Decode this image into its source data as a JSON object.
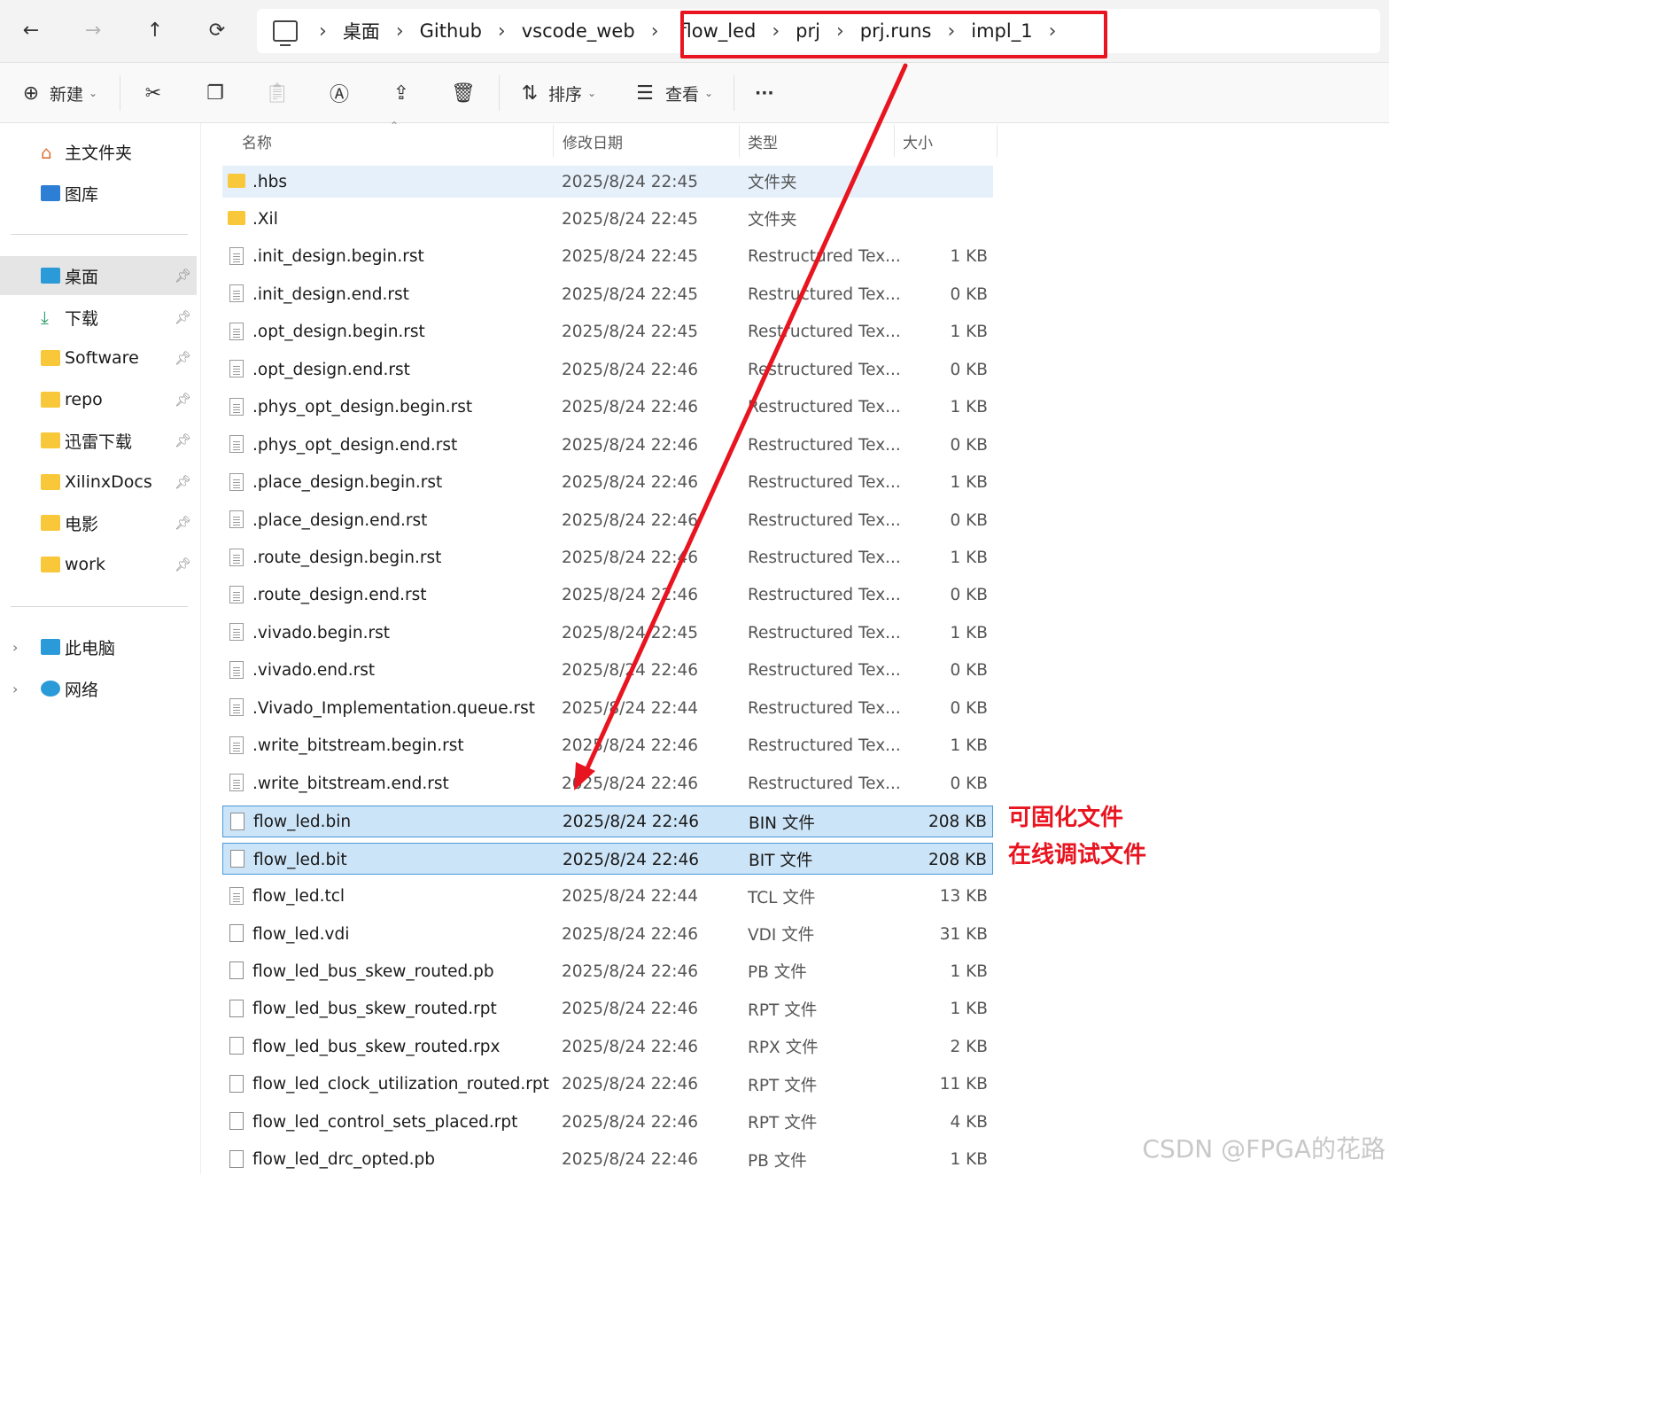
{
  "nav": {
    "back": "←",
    "forward": "→",
    "up": "↑",
    "refresh": "⟳"
  },
  "breadcrumb": [
    "桌面",
    "Github",
    "vscode_web",
    "flow_led",
    "prj",
    "prj.runs",
    "impl_1"
  ],
  "toolbar": {
    "new_label": "新建",
    "sort_label": "排序",
    "view_label": "查看",
    "more_label": "···"
  },
  "sidebar": {
    "quick": [
      {
        "label": "主文件夹"
      },
      {
        "label": "图库"
      }
    ],
    "pinned": [
      {
        "label": "桌面"
      },
      {
        "label": "下载"
      },
      {
        "label": "Software"
      },
      {
        "label": "repo"
      },
      {
        "label": "迅雷下载"
      },
      {
        "label": "XilinxDocs"
      },
      {
        "label": "电影"
      },
      {
        "label": "work"
      }
    ],
    "devices": [
      {
        "label": "此电脑"
      },
      {
        "label": "网络"
      }
    ]
  },
  "columns": {
    "name": "名称",
    "date": "修改日期",
    "type": "类型",
    "size": "大小"
  },
  "files": [
    {
      "name": ".hbs",
      "date": "2025/8/24 22:45",
      "type": "文件夹",
      "size": ""
    },
    {
      "name": ".Xil",
      "date": "2025/8/24 22:45",
      "type": "文件夹",
      "size": ""
    },
    {
      "name": ".init_design.begin.rst",
      "date": "2025/8/24 22:45",
      "type": "Restructured Tex...",
      "size": "1 KB"
    },
    {
      "name": ".init_design.end.rst",
      "date": "2025/8/24 22:45",
      "type": "Restructured Tex...",
      "size": "0 KB"
    },
    {
      "name": ".opt_design.begin.rst",
      "date": "2025/8/24 22:45",
      "type": "Restructured Tex...",
      "size": "1 KB"
    },
    {
      "name": ".opt_design.end.rst",
      "date": "2025/8/24 22:46",
      "type": "Restructured Tex...",
      "size": "0 KB"
    },
    {
      "name": ".phys_opt_design.begin.rst",
      "date": "2025/8/24 22:46",
      "type": "Restructured Tex...",
      "size": "1 KB"
    },
    {
      "name": ".phys_opt_design.end.rst",
      "date": "2025/8/24 22:46",
      "type": "Restructured Tex...",
      "size": "0 KB"
    },
    {
      "name": ".place_design.begin.rst",
      "date": "2025/8/24 22:46",
      "type": "Restructured Tex...",
      "size": "1 KB"
    },
    {
      "name": ".place_design.end.rst",
      "date": "2025/8/24 22:46",
      "type": "Restructured Tex...",
      "size": "0 KB"
    },
    {
      "name": ".route_design.begin.rst",
      "date": "2025/8/24 22:46",
      "type": "Restructured Tex...",
      "size": "1 KB"
    },
    {
      "name": ".route_design.end.rst",
      "date": "2025/8/24 22:46",
      "type": "Restructured Tex...",
      "size": "0 KB"
    },
    {
      "name": ".vivado.begin.rst",
      "date": "2025/8/24 22:45",
      "type": "Restructured Tex...",
      "size": "1 KB"
    },
    {
      "name": ".vivado.end.rst",
      "date": "2025/8/24 22:46",
      "type": "Restructured Tex...",
      "size": "0 KB"
    },
    {
      "name": ".Vivado_Implementation.queue.rst",
      "date": "2025/8/24 22:44",
      "type": "Restructured Tex...",
      "size": "0 KB"
    },
    {
      "name": ".write_bitstream.begin.rst",
      "date": "2025/8/24 22:46",
      "type": "Restructured Tex...",
      "size": "1 KB"
    },
    {
      "name": ".write_bitstream.end.rst",
      "date": "2025/8/24 22:46",
      "type": "Restructured Tex...",
      "size": "0 KB"
    },
    {
      "name": "flow_led.bin",
      "date": "2025/8/24 22:46",
      "type": "BIN 文件",
      "size": "208 KB"
    },
    {
      "name": "flow_led.bit",
      "date": "2025/8/24 22:46",
      "type": "BIT 文件",
      "size": "208 KB"
    },
    {
      "name": "flow_led.tcl",
      "date": "2025/8/24 22:44",
      "type": "TCL 文件",
      "size": "13 KB"
    },
    {
      "name": "flow_led.vdi",
      "date": "2025/8/24 22:46",
      "type": "VDI 文件",
      "size": "31 KB"
    },
    {
      "name": "flow_led_bus_skew_routed.pb",
      "date": "2025/8/24 22:46",
      "type": "PB 文件",
      "size": "1 KB"
    },
    {
      "name": "flow_led_bus_skew_routed.rpt",
      "date": "2025/8/24 22:46",
      "type": "RPT 文件",
      "size": "1 KB"
    },
    {
      "name": "flow_led_bus_skew_routed.rpx",
      "date": "2025/8/24 22:46",
      "type": "RPX 文件",
      "size": "2 KB"
    },
    {
      "name": "flow_led_clock_utilization_routed.rpt",
      "date": "2025/8/24 22:46",
      "type": "RPT 文件",
      "size": "11 KB"
    },
    {
      "name": "flow_led_control_sets_placed.rpt",
      "date": "2025/8/24 22:46",
      "type": "RPT 文件",
      "size": "4 KB"
    },
    {
      "name": "flow_led_drc_opted.pb",
      "date": "2025/8/24 22:46",
      "type": "PB 文件",
      "size": "1 KB"
    }
  ],
  "annotations": {
    "bin_note": "可固化文件",
    "bit_note": "在线调试文件"
  },
  "watermark": "CSDN @FPGA的花路",
  "colors": {
    "annotation": "#e8141f",
    "selection": "#cce4f7",
    "folder": "#f8c83a"
  }
}
